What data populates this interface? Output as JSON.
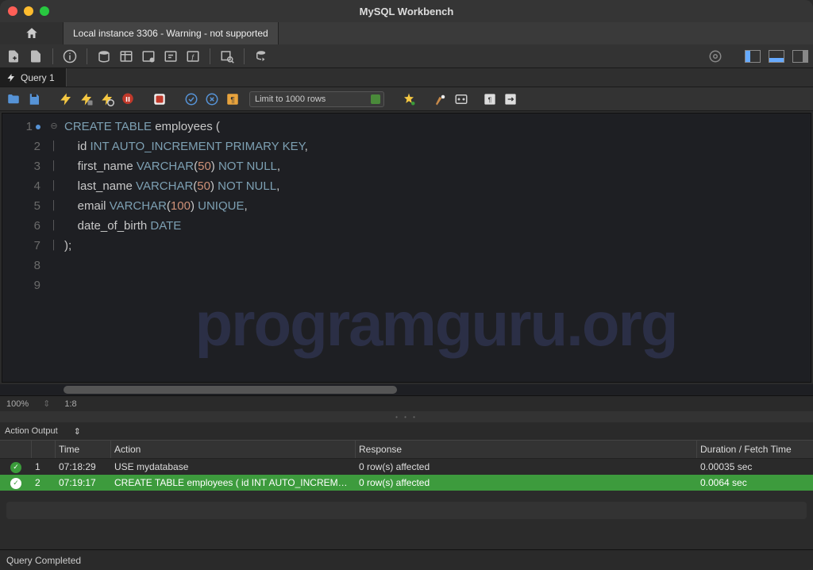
{
  "window": {
    "title": "MySQL Workbench"
  },
  "connection_tab": "Local instance 3306 - Warning - not supported",
  "query_tab": "Query 1",
  "limit_dropdown": "Limit to 1000 rows",
  "zoom": "100%",
  "cursor_pos": "1:8",
  "watermark": "programguru.org",
  "code_lines": [
    {
      "n": 1,
      "tokens": [
        {
          "t": "CREATE",
          "c": "kw"
        },
        {
          "t": " ",
          "c": "p"
        },
        {
          "t": "TABLE",
          "c": "kw"
        },
        {
          "t": " employees ",
          "c": "id"
        },
        {
          "t": "(",
          "c": "p"
        }
      ]
    },
    {
      "n": 2,
      "tokens": [
        {
          "t": "    id ",
          "c": "id"
        },
        {
          "t": "INT",
          "c": "kw"
        },
        {
          "t": " ",
          "c": "p"
        },
        {
          "t": "AUTO_INCREMENT",
          "c": "kw"
        },
        {
          "t": " ",
          "c": "p"
        },
        {
          "t": "PRIMARY",
          "c": "kw"
        },
        {
          "t": " ",
          "c": "p"
        },
        {
          "t": "KEY",
          "c": "kw"
        },
        {
          "t": ",",
          "c": "p"
        }
      ]
    },
    {
      "n": 3,
      "tokens": [
        {
          "t": "    first_name ",
          "c": "id"
        },
        {
          "t": "VARCHAR",
          "c": "kw"
        },
        {
          "t": "(",
          "c": "p"
        },
        {
          "t": "50",
          "c": "num"
        },
        {
          "t": ") ",
          "c": "p"
        },
        {
          "t": "NOT",
          "c": "kw"
        },
        {
          "t": " ",
          "c": "p"
        },
        {
          "t": "NULL",
          "c": "kw"
        },
        {
          "t": ",",
          "c": "p"
        }
      ]
    },
    {
      "n": 4,
      "tokens": [
        {
          "t": "    last_name ",
          "c": "id"
        },
        {
          "t": "VARCHAR",
          "c": "kw"
        },
        {
          "t": "(",
          "c": "p"
        },
        {
          "t": "50",
          "c": "num"
        },
        {
          "t": ") ",
          "c": "p"
        },
        {
          "t": "NOT",
          "c": "kw"
        },
        {
          "t": " ",
          "c": "p"
        },
        {
          "t": "NULL",
          "c": "kw"
        },
        {
          "t": ",",
          "c": "p"
        }
      ]
    },
    {
      "n": 5,
      "tokens": [
        {
          "t": "    email ",
          "c": "id"
        },
        {
          "t": "VARCHAR",
          "c": "kw"
        },
        {
          "t": "(",
          "c": "p"
        },
        {
          "t": "100",
          "c": "num"
        },
        {
          "t": ") ",
          "c": "p"
        },
        {
          "t": "UNIQUE",
          "c": "kw"
        },
        {
          "t": ",",
          "c": "p"
        }
      ]
    },
    {
      "n": 6,
      "tokens": [
        {
          "t": "    date_of_birth ",
          "c": "id"
        },
        {
          "t": "DATE",
          "c": "kw"
        }
      ]
    },
    {
      "n": 7,
      "tokens": [
        {
          "t": ");",
          "c": "p"
        }
      ]
    },
    {
      "n": 8,
      "tokens": []
    },
    {
      "n": 9,
      "tokens": []
    }
  ],
  "output_label": "Action Output",
  "headers": {
    "time": "Time",
    "action": "Action",
    "response": "Response",
    "duration": "Duration / Fetch Time"
  },
  "rows": [
    {
      "n": "1",
      "time": "07:18:29",
      "action": "USE mydatabase",
      "response": "0 row(s) affected",
      "duration": "0.00035 sec",
      "hl": false
    },
    {
      "n": "2",
      "time": "07:19:17",
      "action": "CREATE TABLE employees (     id INT AUTO_INCREMEN...",
      "response": "0 row(s) affected",
      "duration": "0.0064 sec",
      "hl": true
    }
  ],
  "footer_status": "Query Completed"
}
